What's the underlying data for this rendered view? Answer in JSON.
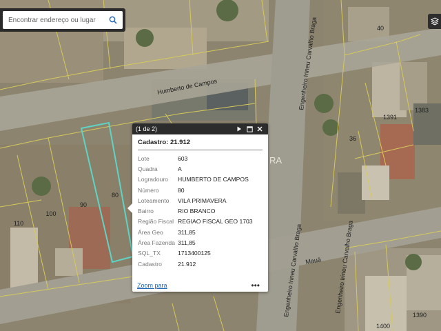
{
  "search": {
    "placeholder": "Encontrar endereço ou lugar"
  },
  "map": {
    "streets": [
      "Humberto de Campos",
      "Engenheiro Irineu Carvalho Braga",
      "Engenheiro Irineu Carvalho Braga",
      "Mauá",
      "Engenheiro Irineu Carvalho Braga"
    ],
    "lot_numbers": [
      "40",
      "1391",
      "1383",
      "36",
      "90",
      "80",
      "110",
      "100",
      "1400",
      "1390"
    ],
    "partial_label": "RA"
  },
  "popup": {
    "count": "(1 de 2)",
    "title": "Cadastro: 21.912",
    "attributes": [
      {
        "key": "Lote",
        "value": "603"
      },
      {
        "key": "Quadra",
        "value": "A"
      },
      {
        "key": "Logradouro",
        "value": "HUMBERTO DE CAMPOS"
      },
      {
        "key": "Número",
        "value": "80"
      },
      {
        "key": "Loteamento",
        "value": "VILA PRIMAVERA"
      },
      {
        "key": "Bairro",
        "value": "RIO BRANCO"
      },
      {
        "key": "Região Fiscal",
        "value": "REGIAO FISCAL GEO 1703"
      },
      {
        "key": "Área Geo",
        "value": "311,85"
      },
      {
        "key": "Área Fazenda",
        "value": "311,85"
      },
      {
        "key": "SQL_TX",
        "value": "1713400125"
      },
      {
        "key": "Cadastro",
        "value": "21.912"
      }
    ],
    "zoom_label": "Zoom para",
    "more_label": "•••"
  }
}
